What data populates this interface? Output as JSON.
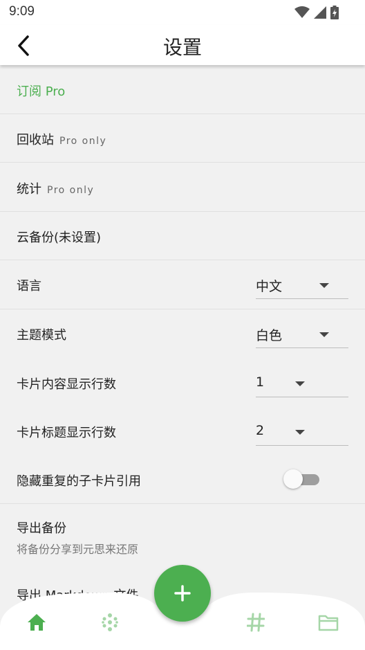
{
  "status_bar": {
    "time": "9:09"
  },
  "app_bar": {
    "title": "设置"
  },
  "colors": {
    "accent": "#4caf50",
    "nav_inactive": "#a5d6a7"
  },
  "settings": {
    "subscribe": {
      "label": "订阅 Pro"
    },
    "recycle_bin": {
      "label": "回收站",
      "tag": "Pro only"
    },
    "statistics": {
      "label": "统计",
      "tag": "Pro only"
    },
    "cloud_backup": {
      "label": "云备份(未设置)"
    },
    "language": {
      "label": "语言",
      "value": "中文"
    },
    "theme": {
      "label": "主题模式",
      "value": "白色"
    },
    "card_content_lines": {
      "label": "卡片内容显示行数",
      "value": "1"
    },
    "card_title_lines": {
      "label": "卡片标题显示行数",
      "value": "2"
    },
    "hide_duplicate_refs": {
      "label": "隐藏重复的子卡片引用",
      "enabled": false
    },
    "export_backup": {
      "label": "导出备份",
      "description": "将备份分享到元思来还原"
    },
    "export_markdown": {
      "label": "导出 Markdown 文件"
    }
  },
  "bottom_nav": {
    "items": [
      {
        "icon": "home-icon",
        "active": true
      },
      {
        "icon": "dots-grid-icon",
        "active": false
      },
      {
        "icon": "hashtag-icon",
        "active": false
      },
      {
        "icon": "folder-icon",
        "active": false
      }
    ],
    "fab_icon": "plus-icon"
  }
}
